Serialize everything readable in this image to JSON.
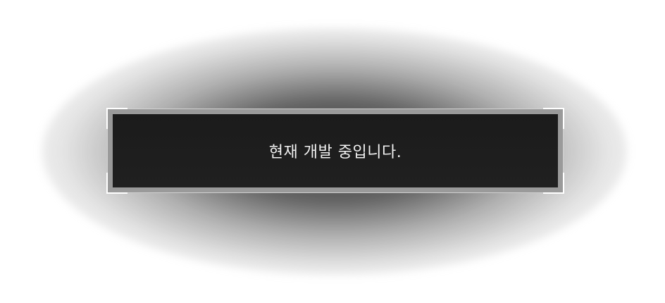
{
  "dialog": {
    "message": "현재 개발 중입니다."
  }
}
